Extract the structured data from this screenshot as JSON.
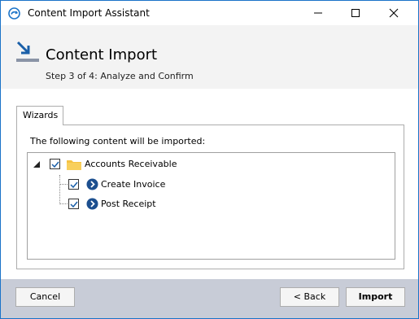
{
  "window": {
    "title": "Content Import Assistant",
    "app_icon": "content-import-icon",
    "controls": {
      "minimize": "minimize-icon",
      "maximize": "maximize-icon",
      "close": "close-icon"
    }
  },
  "header": {
    "title": "Content Import",
    "subtitle": "Step 3 of 4: Analyze and Confirm",
    "icon": "import-arrow-icon"
  },
  "tabs": [
    {
      "label": "Wizards",
      "active": true
    }
  ],
  "panel": {
    "label": "The following content will be imported:"
  },
  "tree": {
    "root": {
      "label": "Accounts Receivable",
      "checked": true,
      "expanded": true,
      "icon": "folder-icon",
      "children": [
        {
          "label": "Create Invoice",
          "checked": true,
          "icon": "wizard-icon"
        },
        {
          "label": "Post Receipt",
          "checked": true,
          "icon": "wizard-icon"
        }
      ]
    }
  },
  "footer": {
    "cancel_label": "Cancel",
    "back_label": "< Back",
    "import_label": "Import"
  },
  "colors": {
    "accent": "#1a73c8",
    "folder": "#f5c242",
    "wizard_icon": "#1c4f8f",
    "footer_bg": "#c8ccd7",
    "header_bg": "#f3f3f3"
  }
}
